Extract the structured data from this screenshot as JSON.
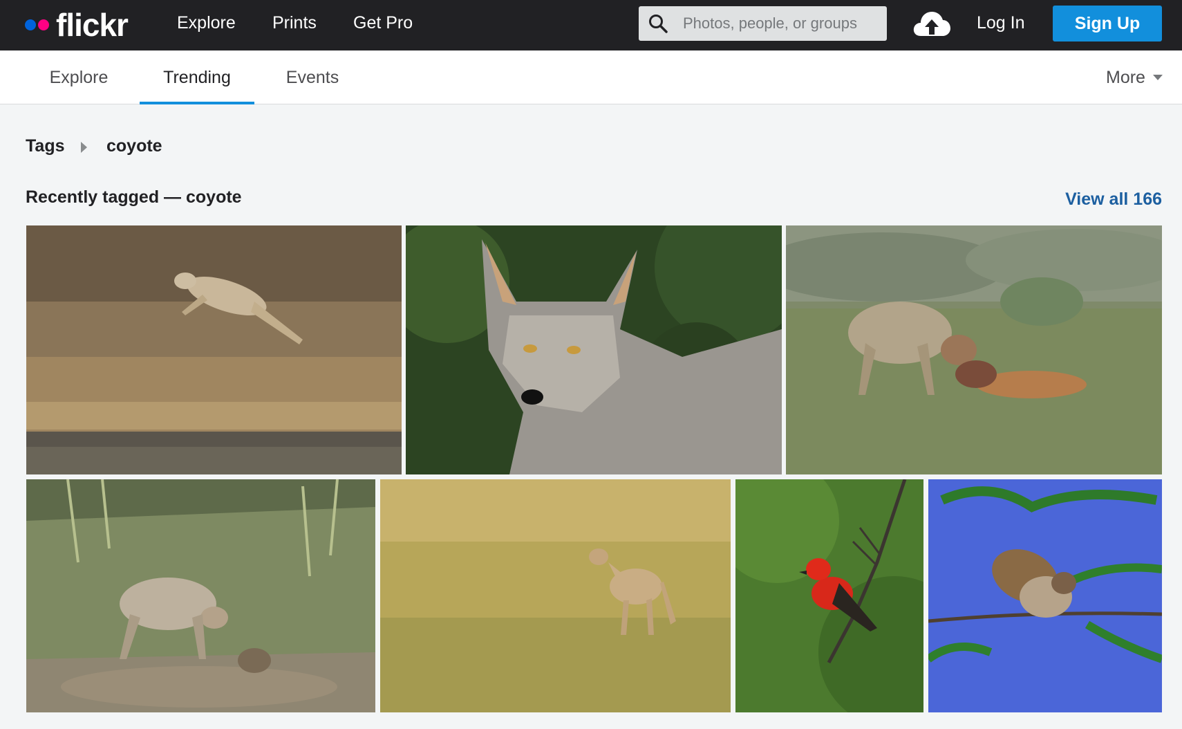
{
  "brand": {
    "name": "flickr"
  },
  "topnav": {
    "explore": "Explore",
    "prints": "Prints",
    "get_pro": "Get Pro"
  },
  "search": {
    "placeholder": "Photos, people, or groups",
    "value": ""
  },
  "auth": {
    "login": "Log In",
    "signup": "Sign Up"
  },
  "subnav": {
    "tabs": [
      {
        "label": "Explore",
        "active": false
      },
      {
        "label": "Trending",
        "active": true
      },
      {
        "label": "Events",
        "active": false
      }
    ],
    "more": "More"
  },
  "breadcrumb": {
    "root": "Tags",
    "current": "coyote"
  },
  "section": {
    "title": "Recently tagged — coyote",
    "view_all": "View all 166"
  },
  "photos": [
    {
      "subject": "coyote leaping over dry grass by water"
    },
    {
      "subject": "close-up portrait of grey coyote"
    },
    {
      "subject": "coyote feeding on calf in meadow"
    },
    {
      "subject": "coyote with pup in tall grass"
    },
    {
      "subject": "coyote standing in golden field"
    },
    {
      "subject": "vermilion flycatcher on branch"
    },
    {
      "subject": "sparrow perched on green branch, blue sky"
    }
  ],
  "colors": {
    "topbar": "#212124",
    "accent": "#128fdc",
    "link": "#1c5fa0",
    "dot_blue": "#0063dc",
    "dot_pink": "#ff0084"
  }
}
